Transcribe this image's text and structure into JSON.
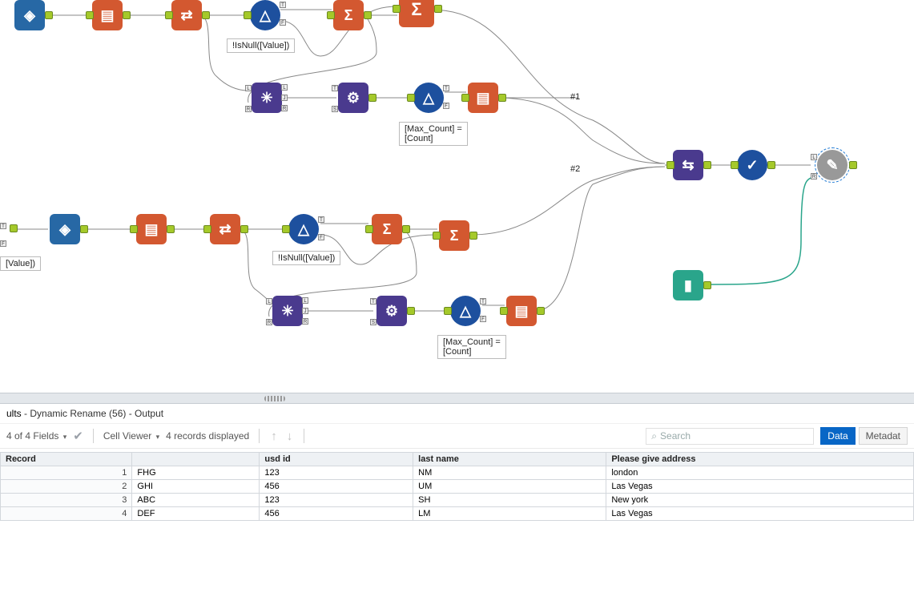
{
  "canvas": {
    "annotations": {
      "a1": "!IsNull([Value])",
      "a2": "[Max_Count] = [Count]",
      "a3": "!IsNull([Value])",
      "a4": "[Max_Count] = [Count]",
      "tail": "[Value])"
    },
    "path_labels": {
      "p1": "#1",
      "p2": "#2"
    },
    "tools": {
      "input": "Input",
      "select": "Select",
      "transpose": "Transpose",
      "filter": "Filter",
      "summarize": "Summarize",
      "join": "Join",
      "formula": "Formula",
      "dynamic_rename": "Dynamic Rename",
      "unique": "Unique",
      "browse": "Browse",
      "macro_input": "Macro Input"
    }
  },
  "results": {
    "title_lead": "ults",
    "title_rest": " - Dynamic Rename (56) - Output",
    "fields_summary": "4 of 4 Fields",
    "cell_viewer": "Cell Viewer",
    "records_summary": "4 records displayed",
    "search_placeholder": "Search",
    "tab_data": "Data",
    "tab_metadata": "Metadat",
    "columns": [
      "Record",
      "",
      "usd id",
      "last name",
      "Please give address"
    ],
    "rows": [
      {
        "n": "1",
        "c1": "FHG",
        "c2": "123",
        "c3": "NM",
        "c4": "london"
      },
      {
        "n": "2",
        "c1": "GHI",
        "c2": "456",
        "c3": "UM",
        "c4": "Las Vegas"
      },
      {
        "n": "3",
        "c1": "ABC",
        "c2": "123",
        "c3": "SH",
        "c4": "New york"
      },
      {
        "n": "4",
        "c1": "DEF",
        "c2": "456",
        "c3": "LM",
        "c4": "Las Vegas"
      }
    ]
  }
}
